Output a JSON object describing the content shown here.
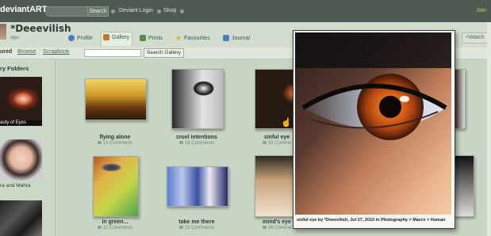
{
  "topbar": {
    "logo": "deviantART",
    "search_button": "Search",
    "links": [
      "Deviant Login",
      "Shop"
    ],
    "join": "Join"
  },
  "profile": {
    "username": "*Deeevilish",
    "tag": "xiyu",
    "tabs": [
      "Profile",
      "Gallery",
      "Prints",
      "Favourites",
      "Journal"
    ],
    "watch": "+Watch"
  },
  "subnav": {
    "featured": "ured",
    "browse": "Browse",
    "scrapbook": "Scrapbook",
    "search_gallery": "Search Gallery"
  },
  "sidebar": {
    "title": "ry Folders",
    "folder1_caption": "auty of Eyes",
    "folder2_label": "ra and Mahra"
  },
  "gallery": {
    "items": [
      {
        "title": "flying alone",
        "comments": "14 Comments"
      },
      {
        "title": "cruel intentions",
        "comments": "18 Comments"
      },
      {
        "title": "sinful eye",
        "comments": "33 Comme"
      },
      {
        "title": "in green...",
        "comments": "22 Comments"
      },
      {
        "title": "take me there",
        "comments": "23 Comments"
      },
      {
        "title": "mind's eye",
        "comments": "36 Comme"
      }
    ]
  },
  "preview": {
    "caption": "sinful eye by *Deeevilish, Jul 27, 2010 in Photography > Macro > Human"
  }
}
